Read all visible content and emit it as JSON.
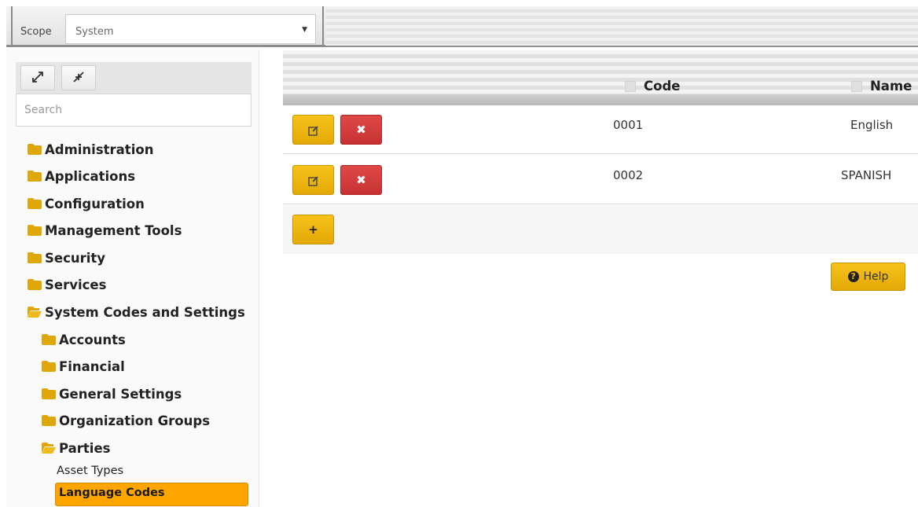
{
  "scope": {
    "label": "Scope",
    "value": "System"
  },
  "sidebar": {
    "tools": {
      "expand_icon": "expand-icon",
      "collapse_icon": "collapse-icon"
    },
    "search_placeholder": "Search",
    "folders": [
      "Administration",
      "Applications",
      "Configuration",
      "Management Tools",
      "Security",
      "Services",
      "System Codes and Settings"
    ],
    "subfolders": [
      "Accounts",
      "Financial",
      "General Settings",
      "Organization Groups",
      "Parties"
    ],
    "leaves": [
      "Asset Types",
      "Language Codes"
    ],
    "selected_leaf": "Language Codes"
  },
  "grid": {
    "columns": [
      "Code",
      "Name"
    ],
    "rows": [
      {
        "code": "0001",
        "name": "English"
      },
      {
        "code": "0002",
        "name": "SPANISH"
      }
    ],
    "add_label": "+",
    "delete_label": "✖",
    "edit_icon": "edit-icon"
  },
  "help": {
    "label": "Help"
  },
  "colors": {
    "accent": "#ffa500",
    "button": "#f2b80f",
    "delete": "#d63b3b",
    "folder": "#e0a70a"
  }
}
